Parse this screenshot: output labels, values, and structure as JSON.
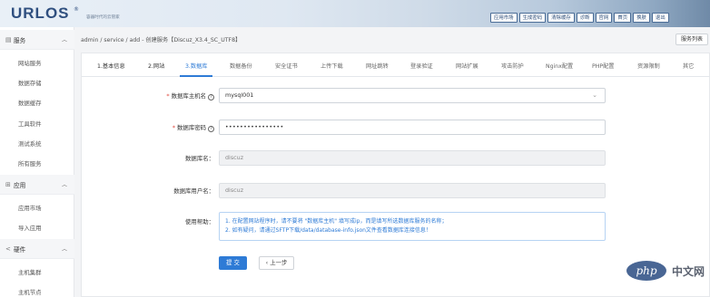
{
  "header": {
    "logo": "URLOS",
    "logo_mark": "®",
    "slogan": "容器时代的云管家",
    "nav": [
      "应用市场",
      "生成密码",
      "清除缓存",
      "诊断",
      "官网",
      "首页",
      "换肤",
      "退出"
    ]
  },
  "sidebar": {
    "groups": [
      {
        "label": "服务",
        "icon": "server-icon",
        "items": [
          "网站服务",
          "数据存储",
          "数据缓存",
          "工具软件",
          "测试系统",
          "所有服务"
        ]
      },
      {
        "label": "应用",
        "icon": "grid-icon",
        "items": [
          "应用市场",
          "导入应用"
        ]
      },
      {
        "label": "硬件",
        "icon": "share-icon",
        "items": [
          "主机集群",
          "主机节点"
        ]
      }
    ]
  },
  "breadcrumb": "admin / service / add - 创建服务【Discuz_X3.4_SC_UTF8】",
  "service_list_button": "服务列表",
  "tabs": [
    "1.基本信息",
    "2.网站",
    "3.数据库",
    "数据备份",
    "安全证书",
    "上传下载",
    "网址跳转",
    "登录验证",
    "网站扩展",
    "攻击防护",
    "Nginx配置",
    "PHP配置",
    "资源限制",
    "其它"
  ],
  "active_tab": "3.数据库",
  "form": {
    "db_host_label": "数据库主机名",
    "db_host_value": "mysql001",
    "db_password_label": "数据库密码",
    "db_password_value": "••••••••••••••••",
    "db_name_label": "数据库名：",
    "db_name_value": "discuz",
    "db_user_label": "数据库用户名：",
    "db_user_value": "discuz",
    "help_label": "使用帮助：",
    "help_lines": [
      "1. 在配置网站程序时，请不要将 \"数据库主机\" 填写成ip，而是填写所选数据库服务的名称；",
      "2. 如有疑问，请通过SFTP下载/data/database-info.json文件查看数据库连接信息！"
    ],
    "submit_label": "提 交",
    "prev_label": "上一步"
  },
  "watermark": {
    "logo_text": "php",
    "text": "中文网"
  },
  "colors": {
    "accent": "#2e7bd6",
    "required": "#e0463b",
    "brand": "#2f4f7f"
  }
}
